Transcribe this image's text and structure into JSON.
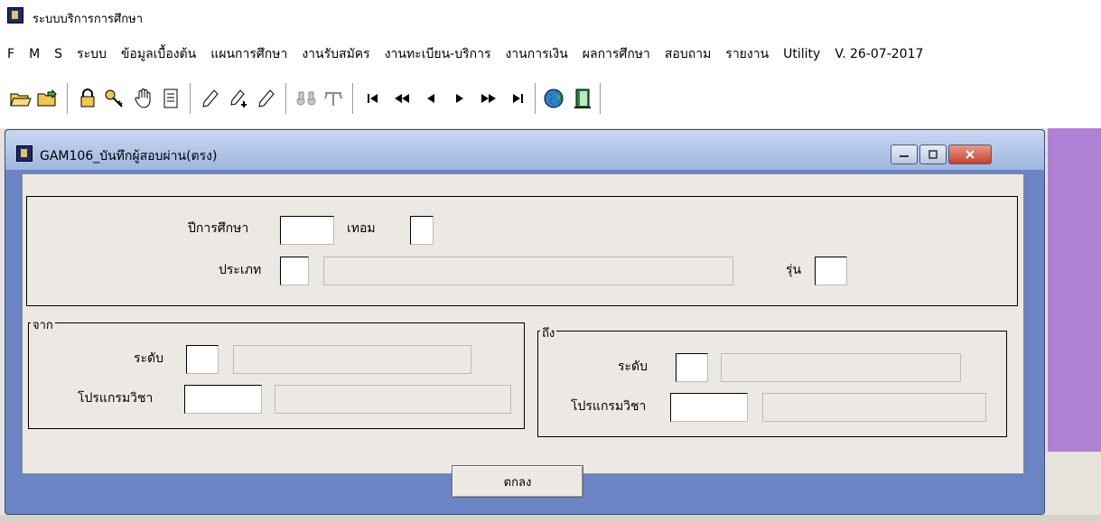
{
  "app": {
    "title": "ระบบบริการการศึกษา"
  },
  "menu": {
    "items": [
      "F",
      "M",
      "S",
      "ระบบ",
      "ข้อมูลเบื้องต้น",
      "แผนการศึกษา",
      "งานรับสมัคร",
      "งานทะเบียน-บริการ",
      "งานการเงิน",
      "ผลการศึกษา",
      "สอบถาม",
      "รายงาน",
      "Utility",
      "V. 26-07-2017"
    ]
  },
  "toolbar": {
    "icons": [
      "open-folder-icon",
      "export-folder-icon",
      "lock-icon",
      "keys-icon",
      "hand-icon",
      "document-icon",
      "pencil-icon",
      "pencil-add-icon",
      "pencil-edit-icon",
      "binoculars-icon",
      "filter-icon",
      "first-record-icon",
      "previous-page-icon",
      "previous-record-icon",
      "next-record-icon",
      "next-page-icon",
      "last-record-icon",
      "globe-icon",
      "exit-door-icon"
    ]
  },
  "window": {
    "title": "GAM106_บันทึกผู้สอบผ่าน(ตรง)",
    "form": {
      "year_label": "ปีการศึกษา",
      "term_label": "เทอม",
      "type_label": "ประเภท",
      "batch_label": "รุ่น",
      "from_group": "จาก",
      "to_group": "ถึง",
      "level_label": "ระดับ",
      "program_label": "โปรแกรมวิชา",
      "ok_button": "ตกลง"
    }
  },
  "colors": {
    "window_frame": "#6a84c4",
    "mdi_accent": "#b07fd6",
    "client_bg": "#ece9e4"
  }
}
